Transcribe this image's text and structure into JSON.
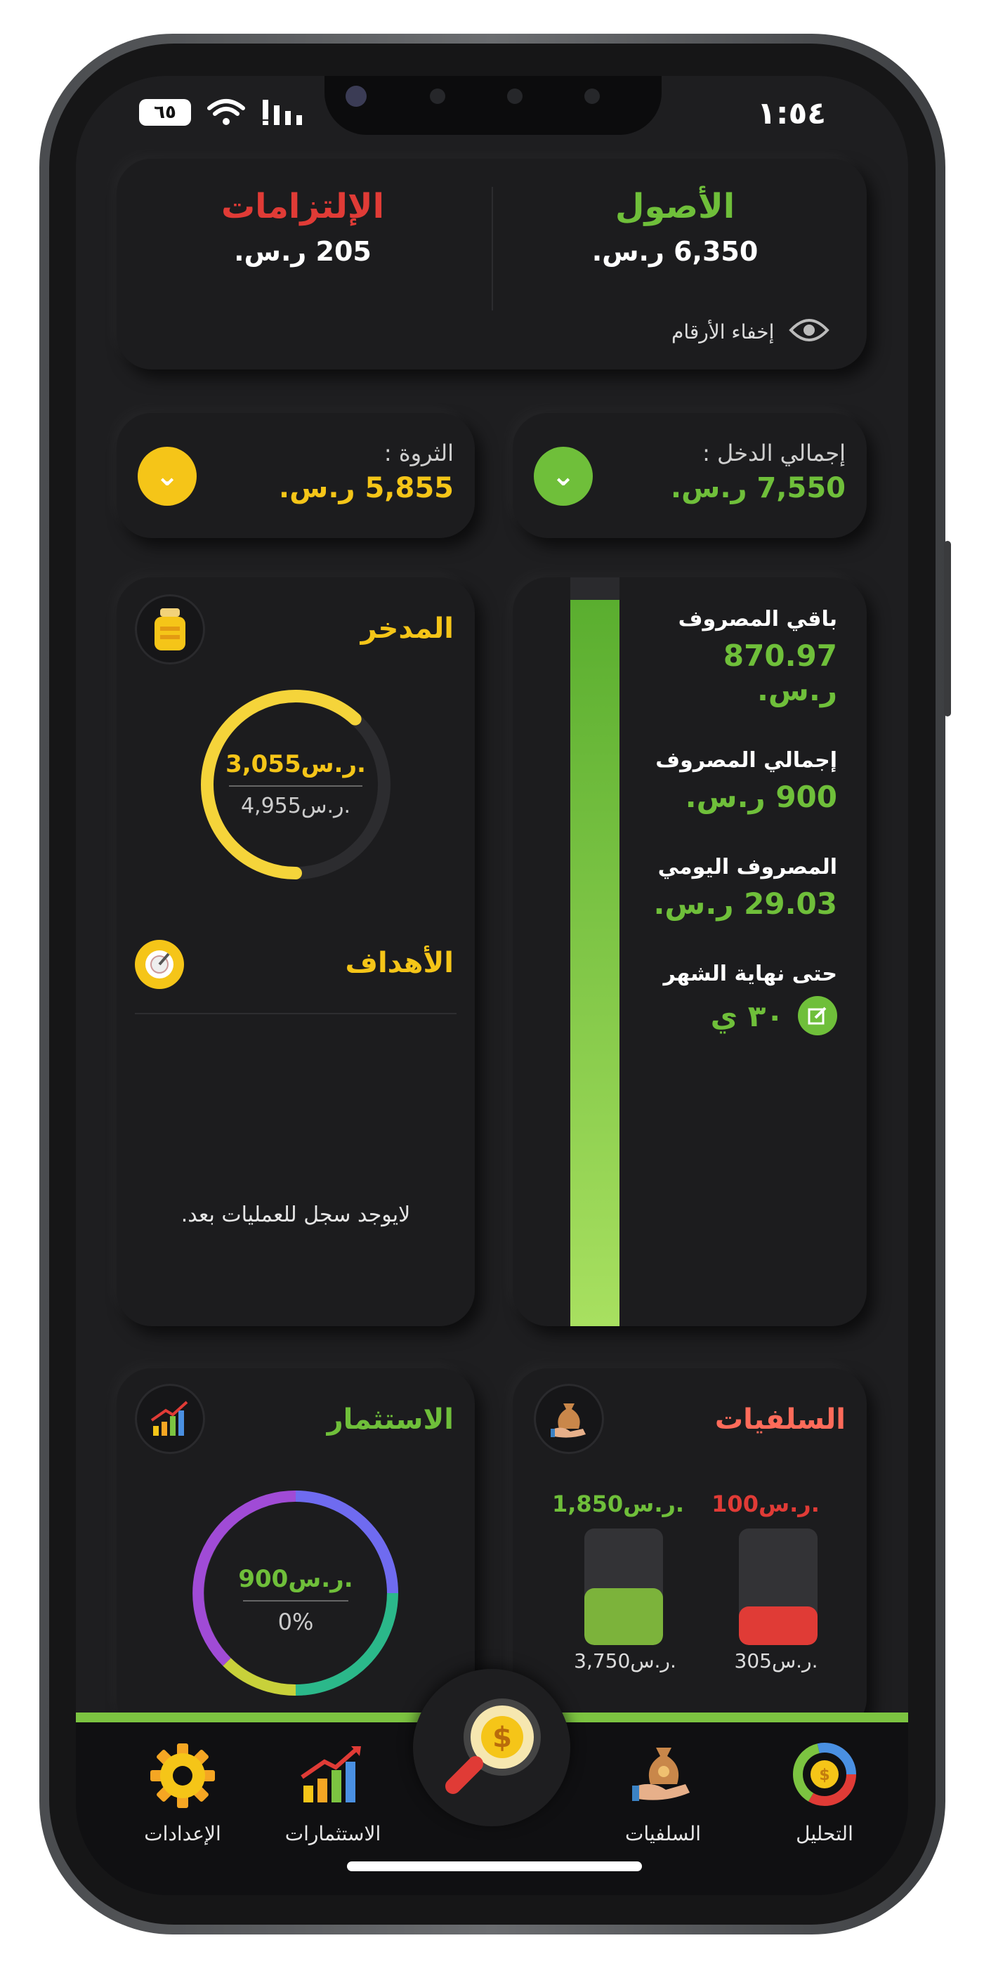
{
  "status": {
    "time": "١:٥٤",
    "battery": "٦٥"
  },
  "summary": {
    "assets_label": "الأصول",
    "assets_value": "6,350 ر.س.",
    "liabilities_label": "الإلتزامات",
    "liabilities_value": "205 ر.س.",
    "hide_numbers_label": "إخفاء الأرقام"
  },
  "income": {
    "label": "إجمالي الدخل :",
    "value": "7,550 ر.س."
  },
  "wealth": {
    "label": "الثروة :",
    "value": "5,855 ر.س."
  },
  "spending": {
    "remaining_label": "باقي المصروف",
    "remaining_value": "870.97 ر.س.",
    "total_label": "إجمالي المصروف",
    "total_value": "900 ر.س.",
    "daily_label": "المصروف اليومي",
    "daily_value": "29.03 ر.س.",
    "month_end_label": "حتى نهاية الشهر",
    "month_end_value": "٣٠ ي",
    "remaining_fraction": 0.97
  },
  "savings": {
    "title": "المدخر",
    "saved": "3,055ر.س.",
    "target": "4,955ر.س.",
    "progress": 0.617
  },
  "goals": {
    "title": "الأهداف",
    "empty_text": "لايوجد سجل للعمليات بعد."
  },
  "loans": {
    "title": "السلفيات",
    "red_top": "100ر.س.",
    "red_bottom": "305ر.س.",
    "red_fill": 0.33,
    "green_top": "1,850ر.س.",
    "green_bottom": "3,750ر.س.",
    "green_fill": 0.49
  },
  "investment": {
    "title": "الاستثمار",
    "value": "900ر.س.",
    "percent": "0%"
  },
  "nav": {
    "analysis": "التحليل",
    "loans": "السلفيات",
    "investments": "الاستثمارات",
    "settings": "الإعدادات"
  },
  "colors": {
    "green": "#6fbf3a",
    "gold": "#f5c518",
    "red": "#e03b36",
    "coral": "#ff6b5a"
  }
}
